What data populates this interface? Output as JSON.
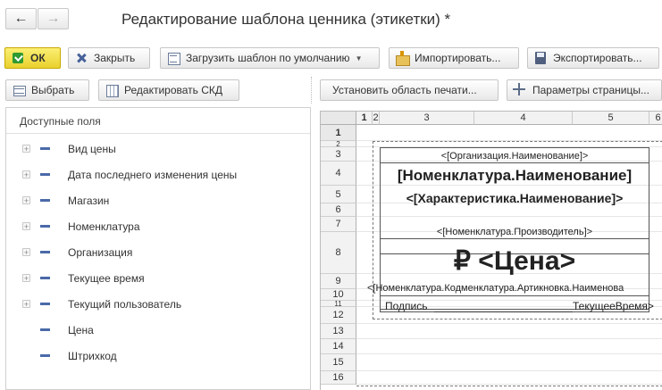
{
  "header": {
    "title": "Редактирование шаблона ценника (этикетки) *"
  },
  "toolbar1": {
    "ok": "ОК",
    "close": "Закрыть",
    "load_default": "Загрузить шаблон по умолчанию",
    "import": "Импортировать...",
    "export": "Экспортировать..."
  },
  "toolbar2": {
    "select": "Выбрать",
    "edit_skd": "Редактировать СКД",
    "set_print_area": "Установить область печати...",
    "page_params": "Параметры страницы..."
  },
  "fields": {
    "header": "Доступные поля",
    "items": [
      {
        "label": "Вид цены",
        "expandable": true
      },
      {
        "label": "Дата последнего изменения цены",
        "expandable": true
      },
      {
        "label": "Магазин",
        "expandable": true
      },
      {
        "label": "Номенклатура",
        "expandable": true
      },
      {
        "label": "Организация",
        "expandable": true
      },
      {
        "label": "Текущее время",
        "expandable": true
      },
      {
        "label": "Текущий пользователь",
        "expandable": true
      },
      {
        "label": "Цена",
        "expandable": false
      },
      {
        "label": "Штрихкод",
        "expandable": false
      }
    ]
  },
  "sheet": {
    "columns": [
      "1",
      "2",
      "3",
      "4",
      "5",
      "6"
    ],
    "rows": [
      "1",
      "2",
      "3",
      "4",
      "5",
      "6",
      "7",
      "8",
      "9",
      "10",
      "11",
      "12",
      "13",
      "14",
      "15",
      "16"
    ],
    "cells": {
      "r3": "<[Организация.Наименование]>",
      "r4": "[Номенклатура.Наименование]",
      "r5": "<[Характеристика.Наименование]>",
      "r7": "<[Номенклатура.Производитель]>",
      "r8": "₽ <Цена>",
      "r9": "<[Номенклатура.Кодменклатура.Артикновка.Наименова",
      "r10_left": "Подпись",
      "r10_right": "ТекущееВремя>"
    }
  }
}
